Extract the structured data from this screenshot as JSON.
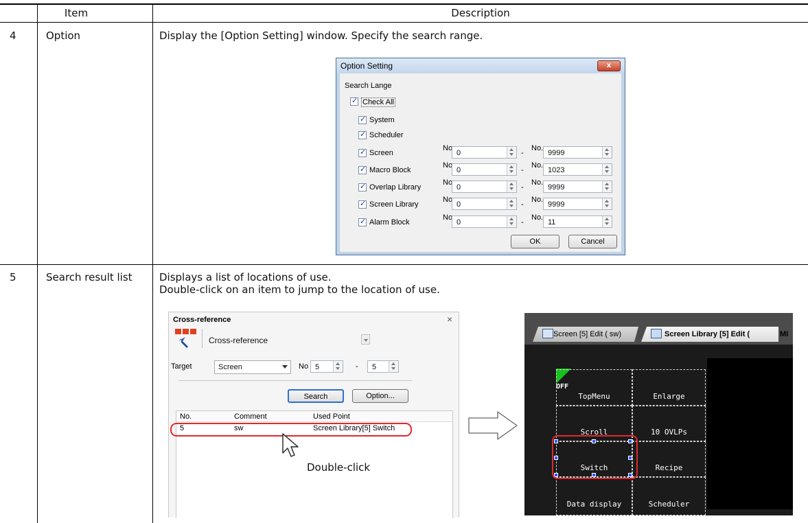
{
  "table": {
    "header": {
      "item": "Item",
      "description": "Description"
    },
    "rows": [
      {
        "no": "4",
        "item": "Option",
        "desc": [
          "Display the [Option Setting] window. Specify the search range."
        ]
      },
      {
        "no": "5",
        "item": "Search result list",
        "desc": [
          "Displays a list of locations of use.",
          "Double-click on an item to jump to the location of use."
        ]
      }
    ]
  },
  "option_dialog": {
    "title": "Option Setting",
    "close_glyph": "x",
    "section_label": "Search Lange",
    "check_all": "Check All",
    "items": [
      {
        "label": "System"
      },
      {
        "label": "Scheduler"
      },
      {
        "label": "Screen",
        "from_label": "No.",
        "from": "0",
        "to_label": "No.",
        "to": "9999"
      },
      {
        "label": "Macro Block",
        "from_label": "No.",
        "from": "0",
        "to_label": "No.",
        "to": "1023"
      },
      {
        "label": "Overlap Library",
        "from_label": "No.",
        "from": "0",
        "to_label": "No.",
        "to": "9999"
      },
      {
        "label": "Screen Library",
        "from_label": "No.",
        "from": "0",
        "to_label": "No.",
        "to": "9999"
      },
      {
        "label": "Alarm Block",
        "from_label": "No.",
        "from": "0",
        "to_label": "No.",
        "to": "11"
      }
    ],
    "dash": "-",
    "ok": "OK",
    "cancel": "Cancel"
  },
  "cross_reference": {
    "title": "Cross-reference",
    "close_glyph": "×",
    "mode_value": "Cross-reference",
    "target_label": "Target",
    "target_value": "Screen",
    "no_label": "No",
    "from": "5",
    "dash": "-",
    "to": "5",
    "search_button": "Search",
    "option_button": "Option...",
    "columns": [
      "No.",
      "Comment",
      "Used Point"
    ],
    "rows": [
      {
        "no": "5",
        "comment": "sw",
        "used_point": "Screen Library[5] Switch"
      }
    ],
    "callout": "Double-click"
  },
  "editor": {
    "tabs": [
      {
        "label": "Screen [5] Edit (       sw)"
      },
      {
        "label": "Screen Library [5] Edit ("
      },
      {
        "label": "MI"
      }
    ],
    "off_label": "OFF",
    "cells": [
      "TopMenu",
      "Enlarge",
      "Scroll",
      "10 OVLPs",
      "Switch",
      "Recipe",
      "Data display",
      "Scheduler"
    ],
    "highlight_color": "#e0282e"
  }
}
